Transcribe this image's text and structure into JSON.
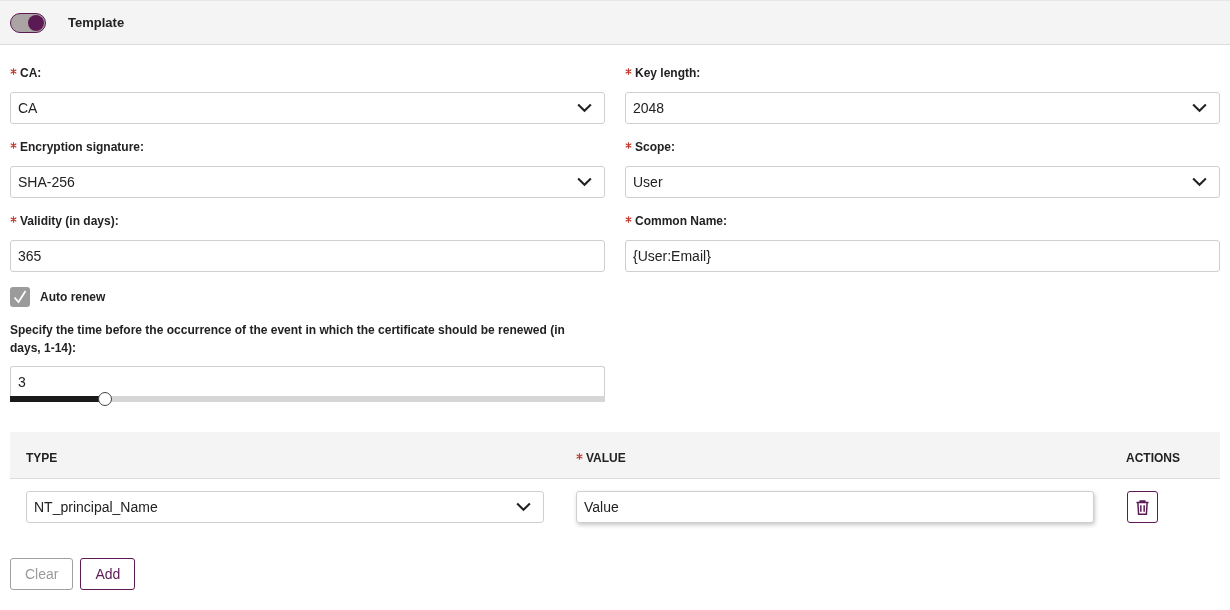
{
  "header": {
    "toggle": {
      "on": true
    },
    "title": "Template"
  },
  "fields": [
    {
      "kind": "select",
      "label": "CA:",
      "required": true,
      "value": "CA"
    },
    {
      "kind": "select",
      "label": "Key length:",
      "required": true,
      "value": "2048"
    },
    {
      "kind": "select",
      "label": "Encryption signature:",
      "required": true,
      "value": "SHA-256"
    },
    {
      "kind": "select",
      "label": "Scope:",
      "required": true,
      "value": "User"
    },
    {
      "kind": "input",
      "label": "Validity (in days):",
      "required": true,
      "value": "365"
    },
    {
      "kind": "input",
      "label": "Common Name:",
      "required": true,
      "value": "{User:Email}"
    }
  ],
  "auto_renew": {
    "label": "Auto renew",
    "checked": true
  },
  "renewal": {
    "label": "Specify the time before the occurrence of the event in which the certificate should be renewed (in days, 1-14):",
    "value": "3",
    "level": 0.16
  },
  "table": {
    "columns": [
      {
        "label": "TYPE",
        "required": false
      },
      {
        "label": "VALUE",
        "required": true
      },
      {
        "label": "ACTIONS",
        "required": false
      }
    ],
    "rows": [
      {
        "type": "NT_principal_Name",
        "value": "Value"
      }
    ]
  },
  "buttons": [
    {
      "label": "Clear",
      "disabled": true
    },
    {
      "label": "Add",
      "disabled": false
    }
  ]
}
